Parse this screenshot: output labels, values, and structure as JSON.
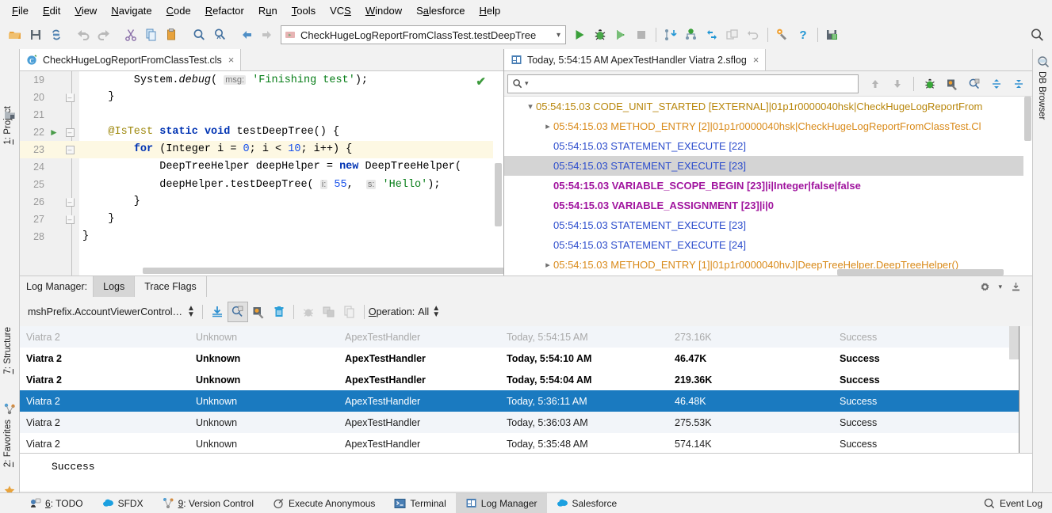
{
  "menubar": {
    "items": [
      {
        "label": "File",
        "accel": "F"
      },
      {
        "label": "Edit",
        "accel": "E"
      },
      {
        "label": "View",
        "accel": "V"
      },
      {
        "label": "Navigate",
        "accel": "N"
      },
      {
        "label": "Code",
        "accel": "C"
      },
      {
        "label": "Refactor",
        "accel": "R"
      },
      {
        "label": "Run",
        "accel": "u"
      },
      {
        "label": "Tools",
        "accel": "T"
      },
      {
        "label": "VCS",
        "accel": "S"
      },
      {
        "label": "Window",
        "accel": "W"
      },
      {
        "label": "Salesforce",
        "accel": "a"
      },
      {
        "label": "Help",
        "accel": "H"
      }
    ]
  },
  "toolbar": {
    "icons": [
      "open-folder-icon",
      "save-all-icon",
      "sync-icon",
      "undo-icon",
      "redo-icon",
      "cut-icon",
      "copy-icon",
      "paste-icon",
      "find-icon",
      "replace-icon",
      "back-icon",
      "forward-icon"
    ],
    "run_config": {
      "label": "CheckHugeLogReportFromClassTest.testDeepTree",
      "chevron": "chevron-down-icon"
    },
    "right_icons": [
      "run-icon",
      "debug-icon",
      "run-coverage-icon",
      "stop-icon",
      "update-project-icon",
      "commit-icon",
      "push-icon",
      "compare-icon",
      "rollback-icon",
      "settings-wrench-icon",
      "help-icon",
      "sfdx-deploy-icon",
      "search-everywhere-icon"
    ]
  },
  "left_stripe": {
    "tabs": [
      {
        "label": "1: Project",
        "accel": "1",
        "icon": "project-icon"
      },
      {
        "label": "7: Structure",
        "accel": "7",
        "icon": "structure-icon"
      },
      {
        "label": "2: Favorites",
        "accel": "2",
        "icon": "favorites-star-icon"
      }
    ]
  },
  "right_stripe": {
    "tabs": [
      {
        "label": "DB Browser",
        "icon": "db-browser-icon"
      }
    ]
  },
  "editor": {
    "tab": {
      "label": "CheckHugeLogReportFromClassTest.cls",
      "icon": "apex-class-icon",
      "close": "×"
    },
    "lines": [
      {
        "num": "19",
        "run": false,
        "fold": "none",
        "hl": false
      },
      {
        "num": "20",
        "run": false,
        "fold": "end",
        "hl": false
      },
      {
        "num": "21",
        "run": false,
        "fold": "none",
        "hl": false
      },
      {
        "num": "22",
        "run": true,
        "fold": "open",
        "hl": false
      },
      {
        "num": "23",
        "run": false,
        "fold": "open",
        "hl": true
      },
      {
        "num": "24",
        "run": false,
        "fold": "none",
        "hl": false
      },
      {
        "num": "25",
        "run": false,
        "fold": "none",
        "hl": false
      },
      {
        "num": "26",
        "run": false,
        "fold": "end",
        "hl": false
      },
      {
        "num": "27",
        "run": false,
        "fold": "end",
        "hl": false
      },
      {
        "num": "28",
        "run": false,
        "fold": "none",
        "hl": false
      }
    ],
    "code": {
      "l19_a": "        System.",
      "l19_b": "debug",
      "l19_c": "( ",
      "l19_hint": "msg:",
      "l19_d": " 'Finishing test'",
      "l19_e": ");",
      "l20": "    }",
      "l21": "",
      "l22_a": "    ",
      "l22_ann": "@IsTest",
      "l22_b": " ",
      "l22_kw1": "static",
      "l22_c": " ",
      "l22_kw2": "void",
      "l22_d": " testDeepTree() {",
      "l23_a": "        ",
      "l23_kw": "for",
      "l23_b": " (Integer i = ",
      "l23_n1": "0",
      "l23_c": "; i < ",
      "l23_n2": "10",
      "l23_d": "; i++) {",
      "l24_a": "            DeepTreeHelper deepHelper = ",
      "l24_kw": "new",
      "l24_b": " DeepTreeHelper(",
      "l25_a": "            deepHelper.testDeepTree( ",
      "l25_hint1": "i:",
      "l25_n": " 55",
      "l25_b": ",  ",
      "l25_hint2": "s:",
      "l25_str": " 'Hello'",
      "l25_c": ");",
      "l26": "        }",
      "l27": "    }",
      "l28": "}"
    },
    "inspection_check": "✔"
  },
  "logviewer": {
    "tab": {
      "label": "Today, 5:54:15 AM ApexTestHandler Viatra 2.sflog",
      "icon": "sflog-file-icon",
      "close": "×"
    },
    "search": {
      "placeholder": "",
      "value": "",
      "icon": "search-icon",
      "chevron": "chevron-down-icon"
    },
    "search_actions": [
      "prev-occurrence-icon",
      "next-occurrence-icon",
      "debug-filter-icon",
      "settings-filter-icon",
      "search-log-icon",
      "expand-all-icon",
      "collapse-all-icon"
    ],
    "tree": [
      {
        "indent": 0,
        "twisty": "expanded",
        "text": "05:54:15.03 CODE_UNIT_STARTED [EXTERNAL]|01p1r0000040hsk|CheckHugeLogReportFrom",
        "kind": "code",
        "selected": false
      },
      {
        "indent": 1,
        "twisty": "collapsed",
        "text": "05:54:15.03 METHOD_ENTRY [2]|01p1r0000040hsk|CheckHugeLogReportFromClassTest.Cl",
        "kind": "method",
        "selected": false
      },
      {
        "indent": 1,
        "twisty": "none",
        "text": "05:54:15.03 STATEMENT_EXECUTE [22]",
        "kind": "stmt",
        "selected": false
      },
      {
        "indent": 1,
        "twisty": "none",
        "text": "05:54:15.03 STATEMENT_EXECUTE [23]",
        "kind": "stmt",
        "selected": true
      },
      {
        "indent": 1,
        "twisty": "none",
        "text": "05:54:15.03 VARIABLE_SCOPE_BEGIN [23]|i|Integer|false|false",
        "kind": "var",
        "selected": false
      },
      {
        "indent": 1,
        "twisty": "none",
        "text": "05:54:15.03 VARIABLE_ASSIGNMENT [23]|i|0",
        "kind": "var",
        "selected": false
      },
      {
        "indent": 1,
        "twisty": "none",
        "text": "05:54:15.03 STATEMENT_EXECUTE [23]",
        "kind": "stmt",
        "selected": false
      },
      {
        "indent": 1,
        "twisty": "none",
        "text": "05:54:15.03 STATEMENT_EXECUTE [24]",
        "kind": "stmt",
        "selected": false
      },
      {
        "indent": 1,
        "twisty": "collapsed",
        "text": "05:54:15.03 METHOD_ENTRY [1]|01p1r0000040hvJ|DeepTreeHelper.DeepTreeHelper()",
        "kind": "method",
        "selected": false
      }
    ]
  },
  "logmanager": {
    "header": {
      "title": "Log Manager:",
      "tabs": [
        {
          "label": "Logs",
          "active": true
        },
        {
          "label": "Trace Flags",
          "active": false
        }
      ],
      "right_icons": [
        "gear-icon",
        "chevron-down-icon",
        "hide-icon"
      ]
    },
    "toolbar": {
      "combo_value": "mshPrefix.AccountViewerControl…",
      "icons": [
        "download-logs-icon",
        "search-log-icon",
        "settings-log-icon",
        "delete-icon",
        "debug-disabled-icon",
        "diff-disabled-icon",
        "copy-disabled-icon"
      ],
      "operation_label": "Operation:",
      "operation_value": "All",
      "operation_accel": "O"
    },
    "table": {
      "rows": [
        {
          "user": "Viatra 2",
          "application": "Unknown",
          "operation": "ApexTestHandler",
          "time": "Today, 5:54:15 AM",
          "size": "273.16K",
          "status": "Success",
          "style": "read0"
        },
        {
          "user": "Viatra 2",
          "application": "Unknown",
          "operation": "ApexTestHandler",
          "time": "Today, 5:54:10 AM",
          "size": "46.47K",
          "status": "Success",
          "style": "unread"
        },
        {
          "user": "Viatra 2",
          "application": "Unknown",
          "operation": "ApexTestHandler",
          "time": "Today, 5:54:04 AM",
          "size": "219.36K",
          "status": "Success",
          "style": "unread"
        },
        {
          "user": "Viatra 2",
          "application": "Unknown",
          "operation": "ApexTestHandler",
          "time": "Today, 5:36:11 AM",
          "size": "46.48K",
          "status": "Success",
          "style": "selected"
        },
        {
          "user": "Viatra 2",
          "application": "Unknown",
          "operation": "ApexTestHandler",
          "time": "Today, 5:36:03 AM",
          "size": "275.53K",
          "status": "Success",
          "style": "alt"
        },
        {
          "user": "Viatra 2",
          "application": "Unknown",
          "operation": "ApexTestHandler",
          "time": "Today, 5:35:48 AM",
          "size": "574.14K",
          "status": "Success",
          "style": "plain"
        }
      ]
    },
    "detail": {
      "text": "Success"
    }
  },
  "statusbar": {
    "items": [
      {
        "label": "6: TODO",
        "accel": "6",
        "icon": "todo-icon",
        "active": false
      },
      {
        "label": "SFDX",
        "icon": "sfdx-cloud-icon",
        "active": false
      },
      {
        "label": "9: Version Control",
        "accel": "9",
        "icon": "vcs-icon",
        "active": false
      },
      {
        "label": "Execute Anonymous",
        "icon": "execute-anonymous-icon",
        "active": false
      },
      {
        "label": "Terminal",
        "icon": "terminal-icon",
        "active": false
      },
      {
        "label": "Log Manager",
        "icon": "log-manager-icon",
        "active": true
      },
      {
        "label": "Salesforce",
        "icon": "salesforce-cloud-icon",
        "active": false
      }
    ],
    "right": {
      "label": "Event Log",
      "icon": "event-log-icon"
    }
  },
  "colors": {
    "accent_selection": "#1a7ac0",
    "tree_code_unit": "#b8860b",
    "tree_method": "#d98a19",
    "tree_statement": "#2b4ccc",
    "tree_variable": "#a0149e",
    "code_keyword": "#0033b3",
    "code_string": "#067d17",
    "code_number": "#1750eb",
    "code_annotation": "#9e880d",
    "highlight_line": "#fdf8e3",
    "panel_bg": "#f2f2f2"
  }
}
